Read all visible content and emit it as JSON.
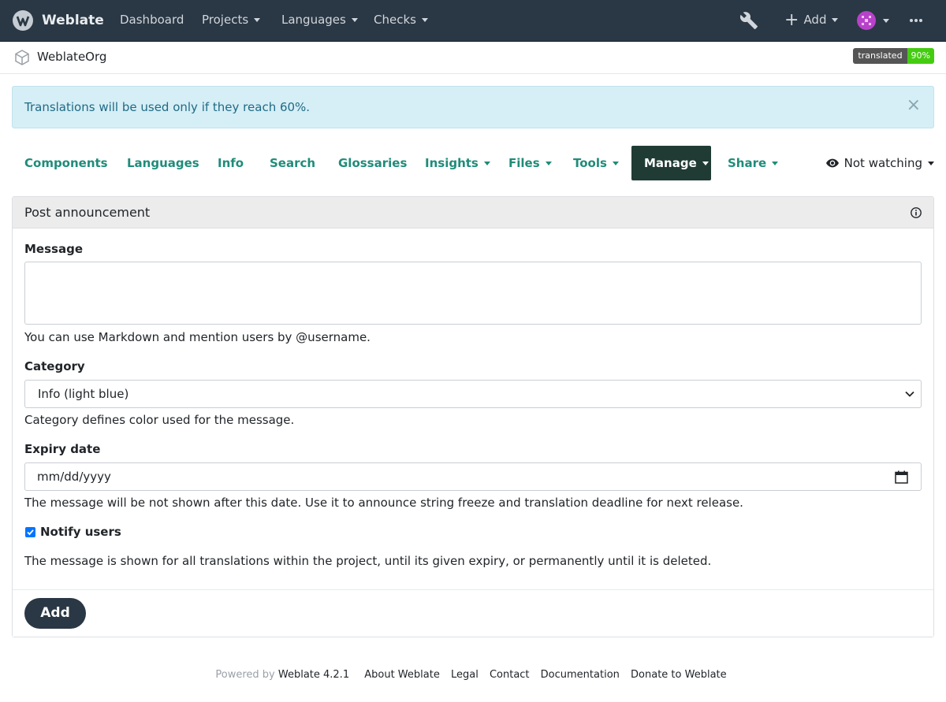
{
  "navbar": {
    "brand": "Weblate",
    "links": {
      "dashboard": "Dashboard",
      "projects": "Projects",
      "languages": "Languages",
      "checks": "Checks"
    },
    "add_label": "Add",
    "icons": [
      "weblate-logo-icon",
      "wrench-icon",
      "plus-icon",
      "avatar-icon",
      "more-icon"
    ]
  },
  "breadcrumb": {
    "project": "WeblateOrg",
    "badge_label": "translated",
    "badge_value": "90%"
  },
  "alert": {
    "text": "Translations will be used only if they reach 60%.",
    "close": "×"
  },
  "tabs": {
    "components": "Components",
    "languages": "Languages",
    "info": "Info",
    "search": "Search",
    "glossaries": "Glossaries",
    "insights": "Insights",
    "files": "Files",
    "tools": "Tools",
    "manage": "Manage",
    "share": "Share",
    "watch": "Not watching"
  },
  "form": {
    "title": "Post announcement",
    "message_label": "Message",
    "message_value": "",
    "message_help": "You can use Markdown and mention users by @username.",
    "category_label": "Category",
    "category_value": "Info (light blue)",
    "category_help": "Category defines color used for the message.",
    "expiry_label": "Expiry date",
    "expiry_placeholder": "mm/dd/yyyy",
    "expiry_help": "The message will be not shown after this date. Use it to announce string freeze and translation deadline for next release.",
    "notify_label": "Notify users",
    "notify_checked": true,
    "notify_help": "The message is shown for all translations within the project, until its given expiry, or permanently until it is deleted.",
    "submit_label": "Add"
  },
  "footer": {
    "powered_by": "Powered by",
    "version": "Weblate 4.2.1",
    "about": "About Weblate",
    "legal": "Legal",
    "contact": "Contact",
    "docs": "Documentation",
    "donate": "Donate to Weblate"
  },
  "colors": {
    "navbar_bg": "#2a3744",
    "accent": "#1f8c7a",
    "active_tab": "#1f3b34",
    "alert_bg": "#d6eef6",
    "badge_green": "#44cc11"
  }
}
